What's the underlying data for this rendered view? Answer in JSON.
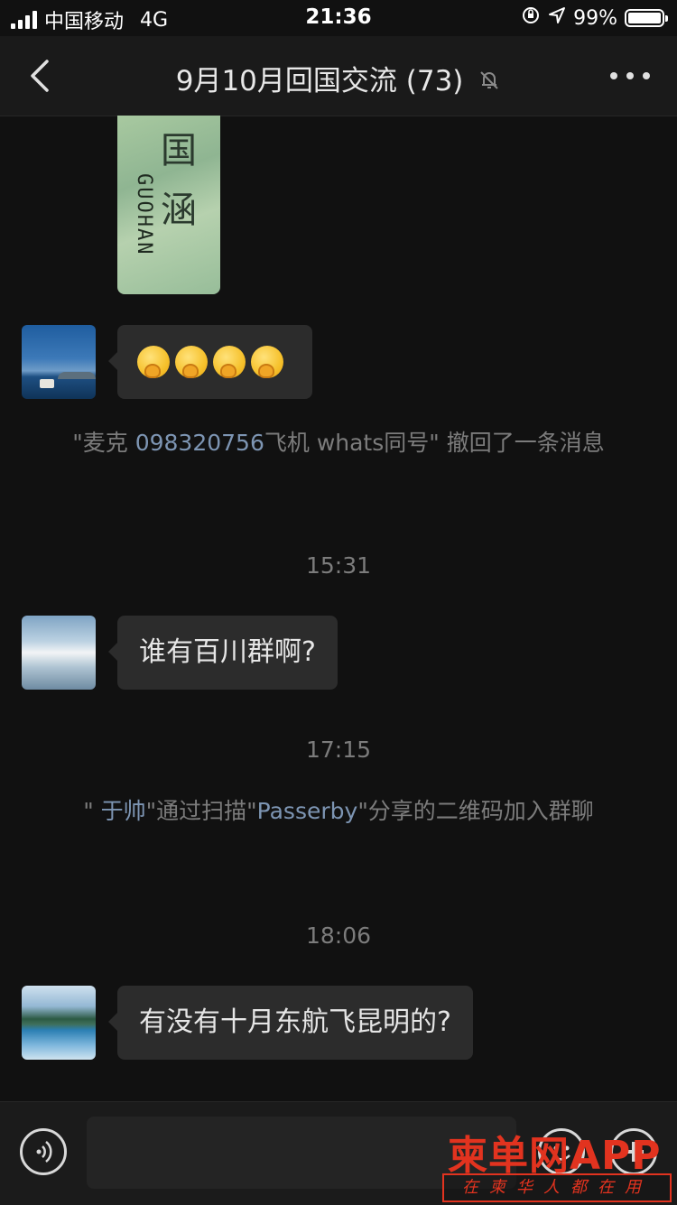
{
  "status_bar": {
    "carrier": "中国移动",
    "network": "4G",
    "time": "21:36",
    "battery": "99%",
    "battery_level": 0.99
  },
  "nav": {
    "title": "9月10月回国交流 (73)"
  },
  "messages": [
    {
      "type": "image",
      "caption_text": "GUOHAN",
      "glyphs": [
        "国",
        "涵"
      ]
    },
    {
      "type": "emoji",
      "emoji_count": 4,
      "emoji_name": "thinking-face"
    },
    {
      "type": "system",
      "prefix": "\"麦克 ",
      "link": "098320756",
      "suffix": "飞机 whats同号\" 撤回了一条消息"
    },
    {
      "type": "timestamp",
      "text": "15:31"
    },
    {
      "type": "text",
      "text": "谁有百川群啊?"
    },
    {
      "type": "timestamp",
      "text": "17:15"
    },
    {
      "type": "system",
      "prefix": "\" ",
      "link": "于帅",
      "middle": "\"通过扫描\"",
      "link2": "Passerby",
      "suffix": "\"分享的二维码加入群聊"
    },
    {
      "type": "timestamp",
      "text": "18:06"
    },
    {
      "type": "text",
      "text": "有没有十月东航飞昆明的?"
    }
  ],
  "watermark": {
    "main": "柬单网APP",
    "sub": "在柬华人都在用"
  },
  "colors": {
    "background": "#111111",
    "bubble": "#2c2c2c",
    "system_text": "#7c7c7c",
    "link": "#7d95b3",
    "watermark": "#e2331f"
  }
}
